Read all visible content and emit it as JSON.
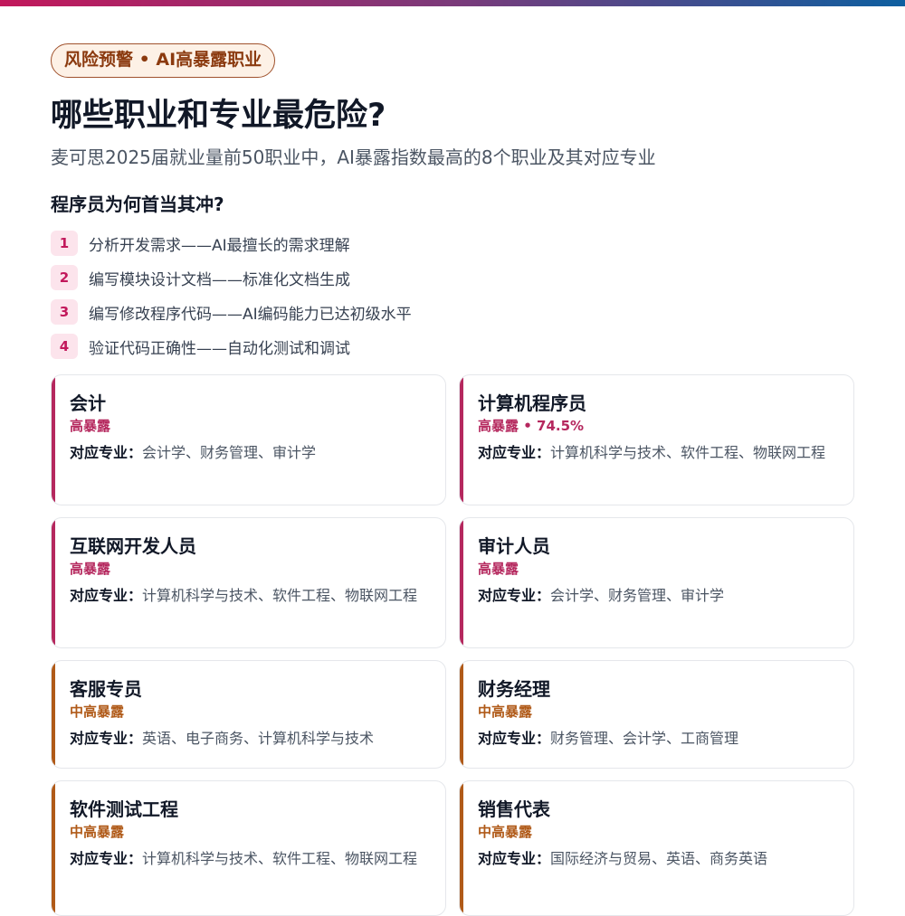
{
  "tag": "风险预警 • AI高暴露职业",
  "title": "哪些职业和专业最危险?",
  "subtitle": "麦可思2025届就业量前50职业中，AI暴露指数最高的8个职业及其对应专业",
  "section": {
    "heading": "程序员为何首当其冲?",
    "steps": [
      {
        "num": "1",
        "text": "分析开发需求——AI最擅长的需求理解"
      },
      {
        "num": "2",
        "text": "编写模块设计文档——标准化文档生成"
      },
      {
        "num": "3",
        "text": "编写修改程序代码——AI编码能力已达初级水平"
      },
      {
        "num": "4",
        "text": "验证代码正确性——自动化测试和调试"
      }
    ]
  },
  "colors": {
    "high": "#b5285e",
    "mid": "#b05a18"
  },
  "majors_label": "对应专业：",
  "occupations": [
    {
      "name": "会计",
      "level": "高暴露",
      "majors": "会计学、财务管理、审计学"
    },
    {
      "name": "计算机程序员",
      "level": "高暴露 • 74.5%",
      "majors": "计算机科学与技术、软件工程、物联网工程"
    },
    {
      "name": "互联网开发人员",
      "level": "高暴露",
      "majors": "计算机科学与技术、软件工程、物联网工程"
    },
    {
      "name": "审计人员",
      "level": "高暴露",
      "majors": "会计学、财务管理、审计学"
    },
    {
      "name": "客服专员",
      "level": "中高暴露",
      "majors": "英语、电子商务、计算机科学与技术"
    },
    {
      "name": "财务经理",
      "level": "中高暴露",
      "majors": "财务管理、会计学、工商管理"
    },
    {
      "name": "软件测试工程",
      "level": "中高暴露",
      "majors": "计算机科学与技术、软件工程、物联网工程"
    },
    {
      "name": "销售代表",
      "level": "中高暴露",
      "majors": "国际经济与贸易、英语、商务英语"
    }
  ]
}
